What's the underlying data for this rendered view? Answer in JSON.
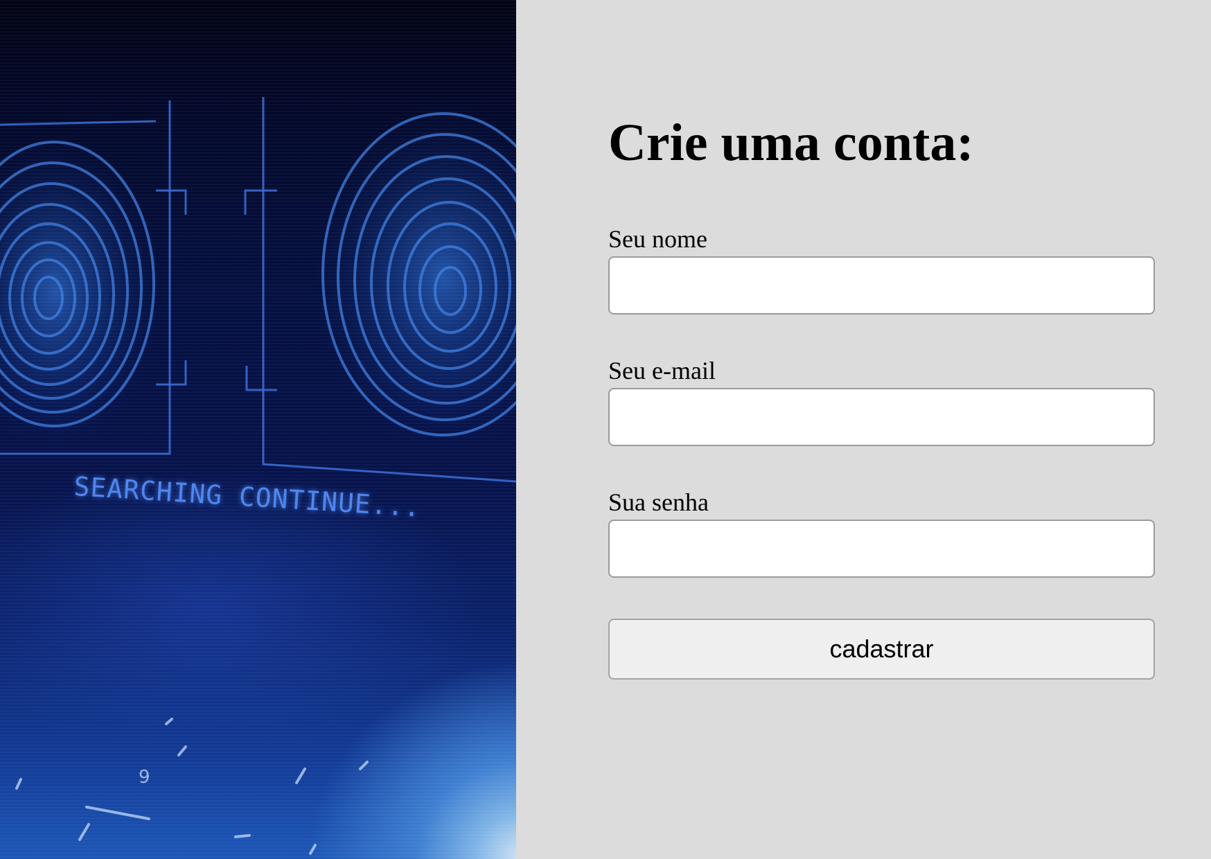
{
  "hero": {
    "caption": "SEARCHING CONTINUE..."
  },
  "form": {
    "title": "Crie uma conta:",
    "name_label": "Seu nome",
    "name_value": "",
    "email_label": "Seu e-mail",
    "email_value": "",
    "password_label": "Sua senha",
    "password_value": "",
    "submit_label": "cadastrar"
  },
  "colors": {
    "panel_background": "#dcdcdc",
    "button_background": "#efefef",
    "hero_accent": "#4f86f0"
  }
}
